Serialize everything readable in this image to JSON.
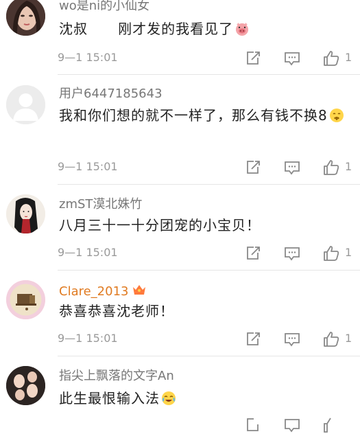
{
  "comments": [
    {
      "username": "wo是ni的小仙女",
      "text": "沈叔      刚才发的我看见了",
      "emoji": "pig-face-emoji",
      "time": "9—1 15:01",
      "likes": "1"
    },
    {
      "username": "用户6447185643",
      "text": "我和你们想的就不一样了，那么有钱不换8",
      "emoji": "shush-face-emoji",
      "time": "9—1 15:01",
      "likes": "1"
    },
    {
      "username": "zmST漠北姝竹",
      "text": "八月三十一十分团宠的小宝贝！",
      "time": "9—1 15:01",
      "likes": "1"
    },
    {
      "username": "Clare_2013",
      "badge": "crown-icon",
      "text": "恭喜恭喜沈老师！",
      "time": "9—1 15:01",
      "likes": "1"
    },
    {
      "username": "指尖上飘落的文字An",
      "text": "此生最恨输入法",
      "emoji": "laugh-cry-emoji"
    }
  ],
  "colors": {
    "username": "#777777",
    "username_vip": "#e07b22",
    "text": "#222222",
    "meta": "#999999",
    "divider": "#e5e5e5"
  }
}
